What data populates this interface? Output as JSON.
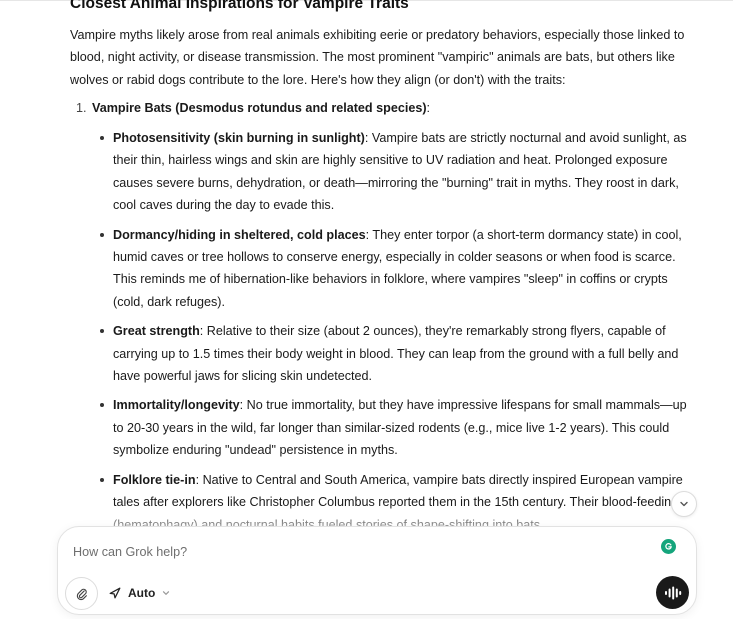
{
  "article": {
    "heading": "Closest Animal Inspirations for Vampire Traits",
    "intro": "Vampire myths likely arose from real animals exhibiting eerie or predatory behaviors, especially those linked to blood, night activity, or disease transmission. The most prominent \"vampiric\" animals are bats, but others like wolves or rabid dogs contribute to the lore. Here's how they align (or don't) with the traits:",
    "item1": {
      "number": "1.",
      "title": "Vampire Bats (Desmodus rotundus and related species)",
      "suffix": ":",
      "bullets": [
        {
          "title": "Photosensitivity (skin burning in sunlight)",
          "text": ": Vampire bats are strictly nocturnal and avoid sunlight, as their thin, hairless wings and skin are highly sensitive to UV radiation and heat. Prolonged exposure causes severe burns, dehydration, or death—mirroring the \"burning\" trait in myths. They roost in dark, cool caves during the day to evade this."
        },
        {
          "title": "Dormancy/hiding in sheltered, cold places",
          "text": ": They enter torpor (a short-term dormancy state) in cool, humid caves or tree hollows to conserve energy, especially in colder seasons or when food is scarce. This reminds me of hibernation-like behaviors in folklore, where vampires \"sleep\" in coffins or crypts (cold, dark refuges)."
        },
        {
          "title": "Great strength",
          "text": ": Relative to their size (about 2 ounces), they're remarkably strong flyers, capable of carrying up to 1.5 times their body weight in blood. They can leap from the ground with a full belly and have powerful jaws for slicing skin undetected."
        },
        {
          "title": "Immortality/longevity",
          "text": ": No true immortality, but they have impressive lifespans for small mammals—up to 20-30 years in the wild, far longer than similar-sized rodents (e.g., mice live 1-2 years). This could symbolize enduring \"undead\" persistence in myths."
        },
        {
          "title": "Folklore tie-in",
          "text": ": Native to Central and South America, vampire bats directly inspired European vampire tales after explorers like Christopher Columbus reported them in the 15th century. Their blood-feeding (hematophagy) and nocturnal habits fueled stories of shape-shifting into bats."
        }
      ]
    }
  },
  "composer": {
    "placeholder": "How can Grok help?",
    "model_label": "Auto"
  },
  "colors": {
    "grammarly": "#15a57c",
    "voice_button": "#1a1a1a"
  },
  "icons": {
    "attach": "paperclip-icon",
    "model": "rocket-icon",
    "voice": "voice-waveform-icon",
    "scroll": "chevron-down-icon",
    "grammarly": "grammarly-icon"
  }
}
